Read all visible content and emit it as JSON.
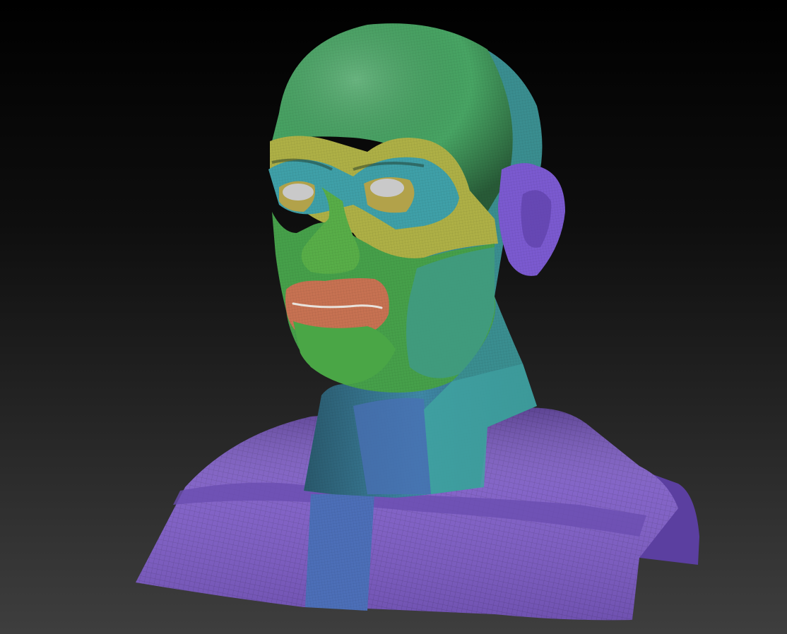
{
  "colors": {
    "background_top": "#000000",
    "background_bottom": "#3e3e3e",
    "polygroup_green": "#4aa84e",
    "polygroup_teal": "#3f9c9a",
    "polygroup_yellow": "#aeb046",
    "polygroup_salmon": "#c77252",
    "polygroup_purple": "#7c5bc4",
    "polygroup_blue": "#4c77b2",
    "eyes": "#c9c9c9"
  },
  "polygroups": [
    "head-top-green",
    "crown-back-teal",
    "brow-band-yellow",
    "eye-socket-teal",
    "face-green",
    "lips-salmon",
    "ear-purple",
    "neck-teal",
    "chest-purple",
    "sternum-blue"
  ]
}
